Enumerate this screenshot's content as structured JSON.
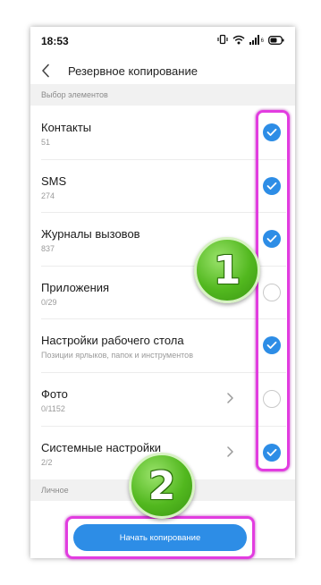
{
  "status_bar": {
    "time": "18:53",
    "battery_label": "6"
  },
  "header": {
    "title": "Резервное копирование"
  },
  "sections": {
    "items_label": "Выбор элементов",
    "personal_label": "Личное"
  },
  "items": [
    {
      "title": "Контакты",
      "subtitle": "51",
      "checked": true,
      "has_chevron": false
    },
    {
      "title": "SMS",
      "subtitle": "274",
      "checked": true,
      "has_chevron": false
    },
    {
      "title": "Журналы вызовов",
      "subtitle": "837",
      "checked": true,
      "has_chevron": false
    },
    {
      "title": "Приложения",
      "subtitle": "0/29",
      "checked": false,
      "has_chevron": false
    },
    {
      "title": "Настройки рабочего стола",
      "subtitle": "Позиции ярлыков, папок и инструментов",
      "checked": true,
      "has_chevron": false
    },
    {
      "title": "Фото",
      "subtitle": "0/1152",
      "checked": false,
      "has_chevron": true
    },
    {
      "title": "Системные настройки",
      "subtitle": "2/2",
      "checked": true,
      "has_chevron": true
    }
  ],
  "action": {
    "start_label": "Начать копирование"
  },
  "annotations": {
    "badge_1": "1",
    "badge_2": "2"
  },
  "colors": {
    "accent": "#2d8de6",
    "highlight": "#e23ce0",
    "badge_green": "#52b81f"
  }
}
